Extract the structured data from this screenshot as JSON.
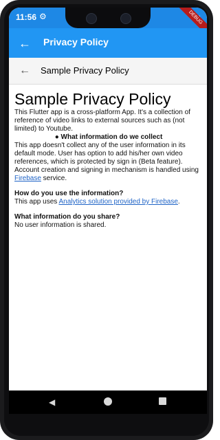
{
  "status_bar": {
    "time": "11:56",
    "debug_label": "DEBUG"
  },
  "app_bar": {
    "title": "Privacy Policy"
  },
  "sub_bar": {
    "title": "Sample Privacy Policy"
  },
  "content": {
    "heading": "Sample Privacy Policy",
    "intro": "This Flutter app is a cross-platform App. It's a collection of reference of video links to external sources such as (not limited) to Youtube.",
    "bullet_title": "What information do we collect",
    "collect_text_1": "This app doesn't collect any of the user information in its default mode. User has option to add his/her own video references, which is protected by sign in (Beta feature). Account creation and signing in mechanism is handled using ",
    "collect_link": "Firebase",
    "collect_text_2": " service.",
    "use_heading": "How do you use the information?",
    "use_text_1": "This app uses ",
    "use_link": "Analytics solution provided by Firebase",
    "use_text_2": ".",
    "share_heading": "What information do you share?",
    "share_text": "No user information is shared."
  },
  "icons": {
    "back": "arrow-left-icon",
    "gear": "gear-icon",
    "wifi": "wifi-icon",
    "battery": "battery-icon",
    "nav_back": "triangle-back-icon",
    "nav_home": "circle-home-icon",
    "nav_recent": "square-recent-icon"
  },
  "colors": {
    "primary": "#2196f3",
    "status_bar": "#1e88e5",
    "link": "#1e63c6"
  }
}
